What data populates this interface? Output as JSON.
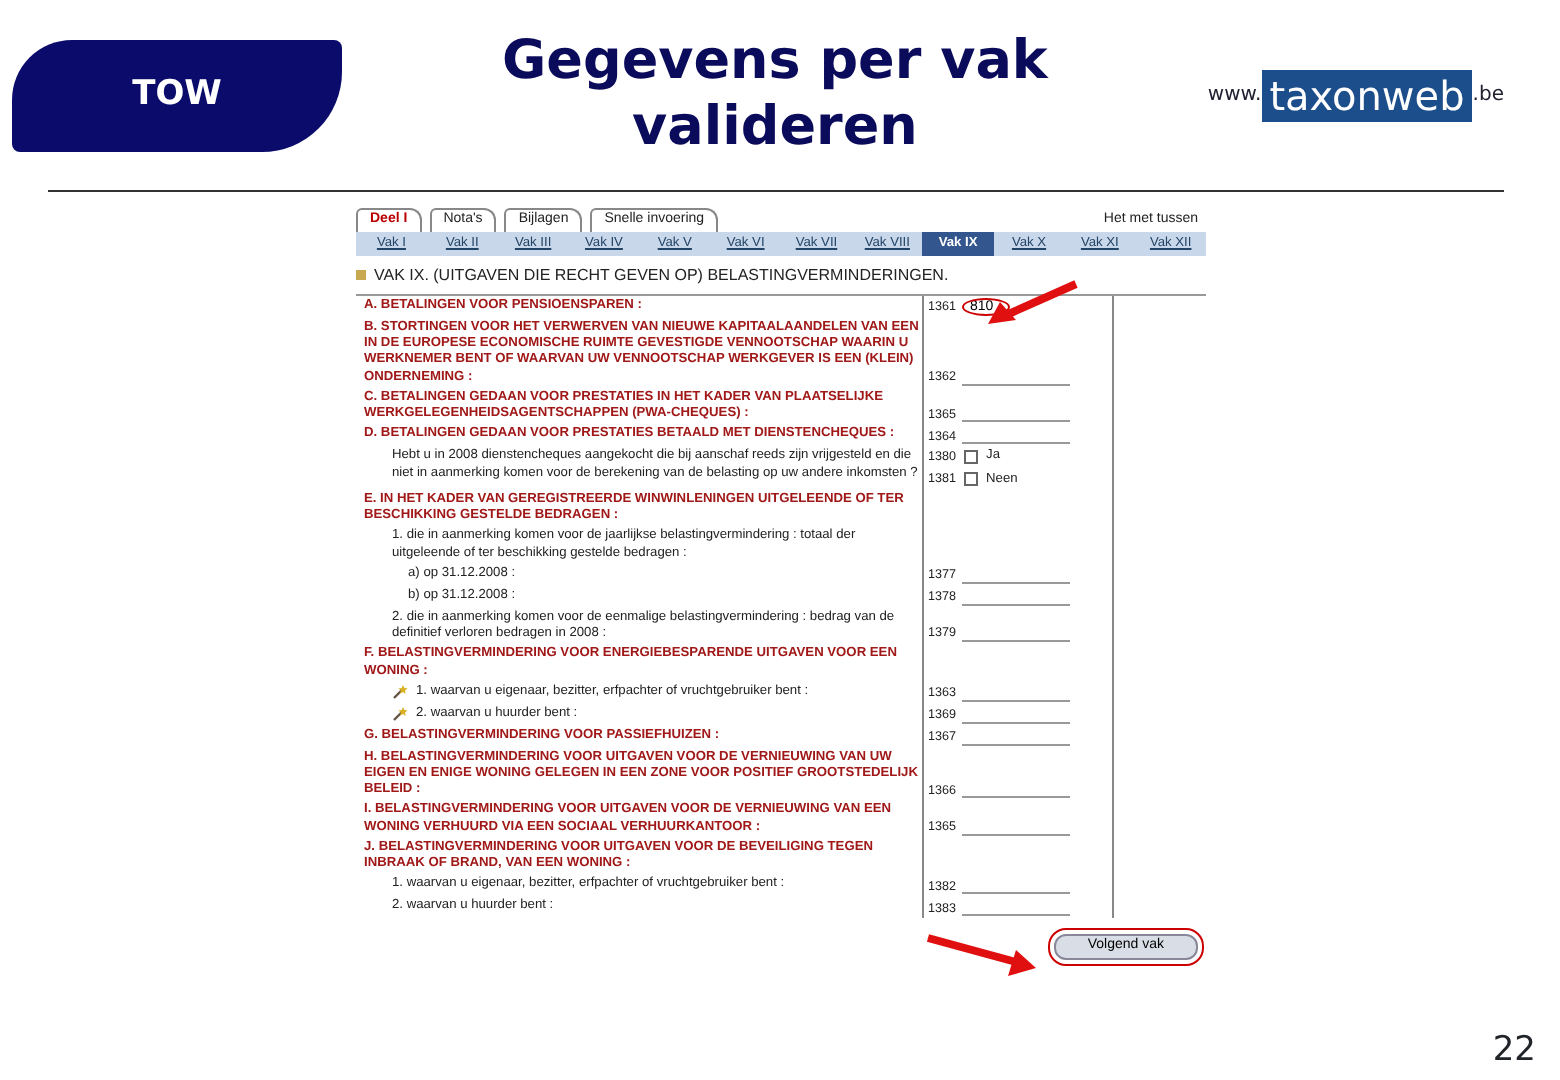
{
  "header": {
    "badge": "TOW",
    "title": "Gegevens per vak valideren",
    "logo": {
      "prefix": "www.",
      "name": "taxonweb",
      "suffix": ".be"
    }
  },
  "screenshot": {
    "tabs": [
      {
        "label": "Deel I",
        "selected": true
      },
      {
        "label": "Nota's",
        "selected": false
      },
      {
        "label": "Bijlagen",
        "selected": false
      },
      {
        "label": "Snelle invoering",
        "selected": false
      }
    ],
    "tool_link": "Het met tussen",
    "subtabs": [
      {
        "label": "Vak I",
        "selected": false
      },
      {
        "label": "Vak II",
        "selected": false
      },
      {
        "label": "Vak III",
        "selected": false
      },
      {
        "label": "Vak IV",
        "selected": false
      },
      {
        "label": "Vak V",
        "selected": false
      },
      {
        "label": "Vak VI",
        "selected": false
      },
      {
        "label": "Vak VII",
        "selected": false
      },
      {
        "label": "Vak VIII",
        "selected": false
      },
      {
        "label": "Vak IX",
        "selected": true
      },
      {
        "label": "Vak X",
        "selected": false
      },
      {
        "label": "Vak XI",
        "selected": false
      },
      {
        "label": "Vak XII",
        "selected": false
      }
    ],
    "heading": "VAK IX.   (UITGAVEN DIE RECHT GEVEN OP) BELASTINGVERMINDERINGEN.",
    "rows": [
      {
        "kind": "section",
        "label": "A. BETALINGEN VOOR PENSIOENSPAREN :",
        "code": "1361",
        "value": "810",
        "highlighted": true
      },
      {
        "kind": "section",
        "label": "B. STORTINGEN VOOR HET VERWERVEN VAN NIEUWE KAPITAALAANDELEN VAN EEN IN DE EUROPESE ECONOMISCHE RUIMTE GEVESTIGDE VENNOOTSCHAP WAARIN U WERKNEMER BENT OF WAARVAN UW VENNOOTSCHAP WERKGEVER IS EEN (KLEIN) ONDERNEMING :",
        "code": "1362"
      },
      {
        "kind": "section",
        "label": "C. BETALINGEN GEDAAN VOOR PRESTATIES IN HET KADER VAN PLAATSELIJKE WERKGELEGENHEIDSAGENTSCHAPPEN (PWA-CHEQUES) :",
        "code": "1365"
      },
      {
        "kind": "section",
        "label": "D. BETALINGEN GEDAAN VOOR PRESTATIES BETAALD MET DIENSTENCHEQUES :",
        "code": "1364"
      },
      {
        "kind": "question",
        "label": "Hebt u in 2008 dienstencheques aangekocht die bij aanschaf reeds zijn vrijgesteld en die niet in aanmerking komen voor de berekening van de belasting op uw andere inkomsten ?",
        "options": [
          {
            "code": "1380",
            "label": "Ja",
            "checked": false
          },
          {
            "code": "1381",
            "label": "Neen",
            "checked": false
          }
        ]
      },
      {
        "kind": "heading",
        "label": "E. IN HET KADER VAN GEREGISTREERDE WINWINLENINGEN UITGELEENDE OF TER BESCHIKKING GESTELDE BEDRAGEN :"
      },
      {
        "kind": "note",
        "label": "1. die in aanmerking komen voor de jaarlijkse belastingvermindering : totaal der uitgeleende of ter beschikking gestelde bedragen :"
      },
      {
        "kind": "subitem",
        "label": "a) op 31.12.2008 :",
        "code": "1377"
      },
      {
        "kind": "subitem",
        "label": "b) op 31.12.2008 :",
        "code": "1378"
      },
      {
        "kind": "item",
        "label": "2. die in aanmerking komen voor de eenmalige belastingvermindering : bedrag van de definitief verloren bedragen in 2008 :",
        "code": "1379"
      },
      {
        "kind": "heading",
        "label": "F. BELASTINGVERMINDERING VOOR ENERGIEBESPARENDE UITGAVEN VOOR EEN WONING :"
      },
      {
        "kind": "wand-item",
        "label": "1. waarvan u eigenaar, bezitter, erfpachter of vruchtgebruiker bent :",
        "code": "1363"
      },
      {
        "kind": "wand-item",
        "label": "2. waarvan u huurder bent :",
        "code": "1369"
      },
      {
        "kind": "section",
        "label": "G. BELASTINGVERMINDERING VOOR PASSIEFHUIZEN :",
        "code": "1367"
      },
      {
        "kind": "section",
        "label": "H. BELASTINGVERMINDERING VOOR UITGAVEN VOOR DE VERNIEUWING VAN UW EIGEN EN ENIGE WONING GELEGEN IN EEN ZONE VOOR POSITIEF GROOTSTEDELIJK BELEID :",
        "code": "1366"
      },
      {
        "kind": "section",
        "label": "I. BELASTINGVERMINDERING VOOR UITGAVEN VOOR DE VERNIEUWING VAN EEN WONING VERHUURD VIA EEN SOCIAAL VERHUURKANTOOR :",
        "code": "1365"
      },
      {
        "kind": "heading",
        "label": "J. BELASTINGVERMINDERING VOOR UITGAVEN VOOR DE BEVEILIGING TEGEN INBRAAK OF BRAND, VAN EEN WONING :"
      },
      {
        "kind": "item",
        "label": "1. waarvan u eigenaar, bezitter, erfpachter of vruchtgebruiker bent :",
        "code": "1382"
      },
      {
        "kind": "item",
        "label": "2. waarvan u huurder bent :",
        "code": "1383"
      }
    ],
    "button": {
      "label": "Volgend vak",
      "highlighted": true
    }
  },
  "page_number": "22"
}
